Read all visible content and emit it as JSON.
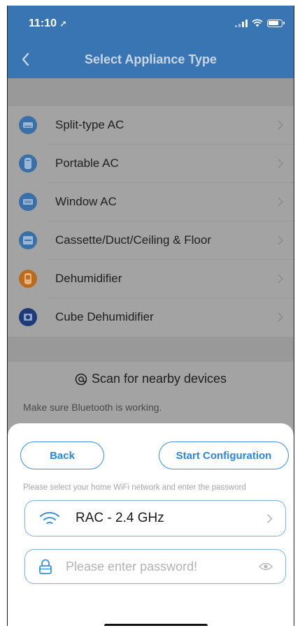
{
  "status_bar": {
    "time": "11:10"
  },
  "header": {
    "title": "Select Appliance Type"
  },
  "appliances": [
    {
      "label": "Split-type AC",
      "icon": "split-ac-icon",
      "color": "#3a6fa8"
    },
    {
      "label": "Portable AC",
      "icon": "portable-ac-icon",
      "color": "#3a6fa8"
    },
    {
      "label": "Window AC",
      "icon": "window-ac-icon",
      "color": "#3a6fa8"
    },
    {
      "label": "Cassette/Duct/Ceiling & Floor",
      "icon": "cassette-ac-icon",
      "color": "#3a6fa8"
    },
    {
      "label": "Dehumidifier",
      "icon": "dehumidifier-icon",
      "color": "#b96b1f"
    },
    {
      "label": "Cube Dehumidifier",
      "icon": "cube-dehumidifier-icon",
      "color": "#1f3a78"
    }
  ],
  "scan": {
    "label": "Scan for nearby devices",
    "hint": "Make sure Bluetooth is working."
  },
  "sheet": {
    "back_label": "Back",
    "start_label": "Start Configuration",
    "instruction": "Please select your home WiFi network and enter the password",
    "wifi_name": "RAC - 2.4 GHz",
    "password_placeholder": "Please enter password!",
    "accent_color": "#2f86d6"
  }
}
